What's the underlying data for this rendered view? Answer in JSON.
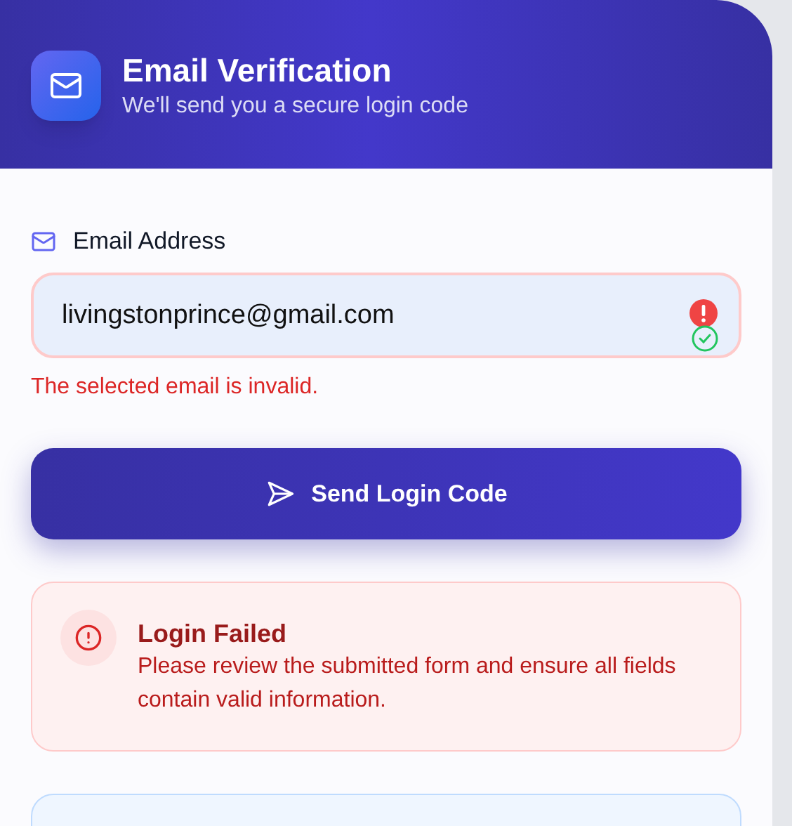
{
  "header": {
    "title": "Email Verification",
    "subtitle": "We'll send you a secure login code"
  },
  "email_field": {
    "label": "Email Address",
    "value": "livingstonprince@gmail.com",
    "invalid": true,
    "error": "The selected email is invalid."
  },
  "submit_button": {
    "label": "Send Login Code"
  },
  "alert": {
    "title": "Login Failed",
    "message": "Please review the submitted form and ensure all fields contain valid information."
  }
}
